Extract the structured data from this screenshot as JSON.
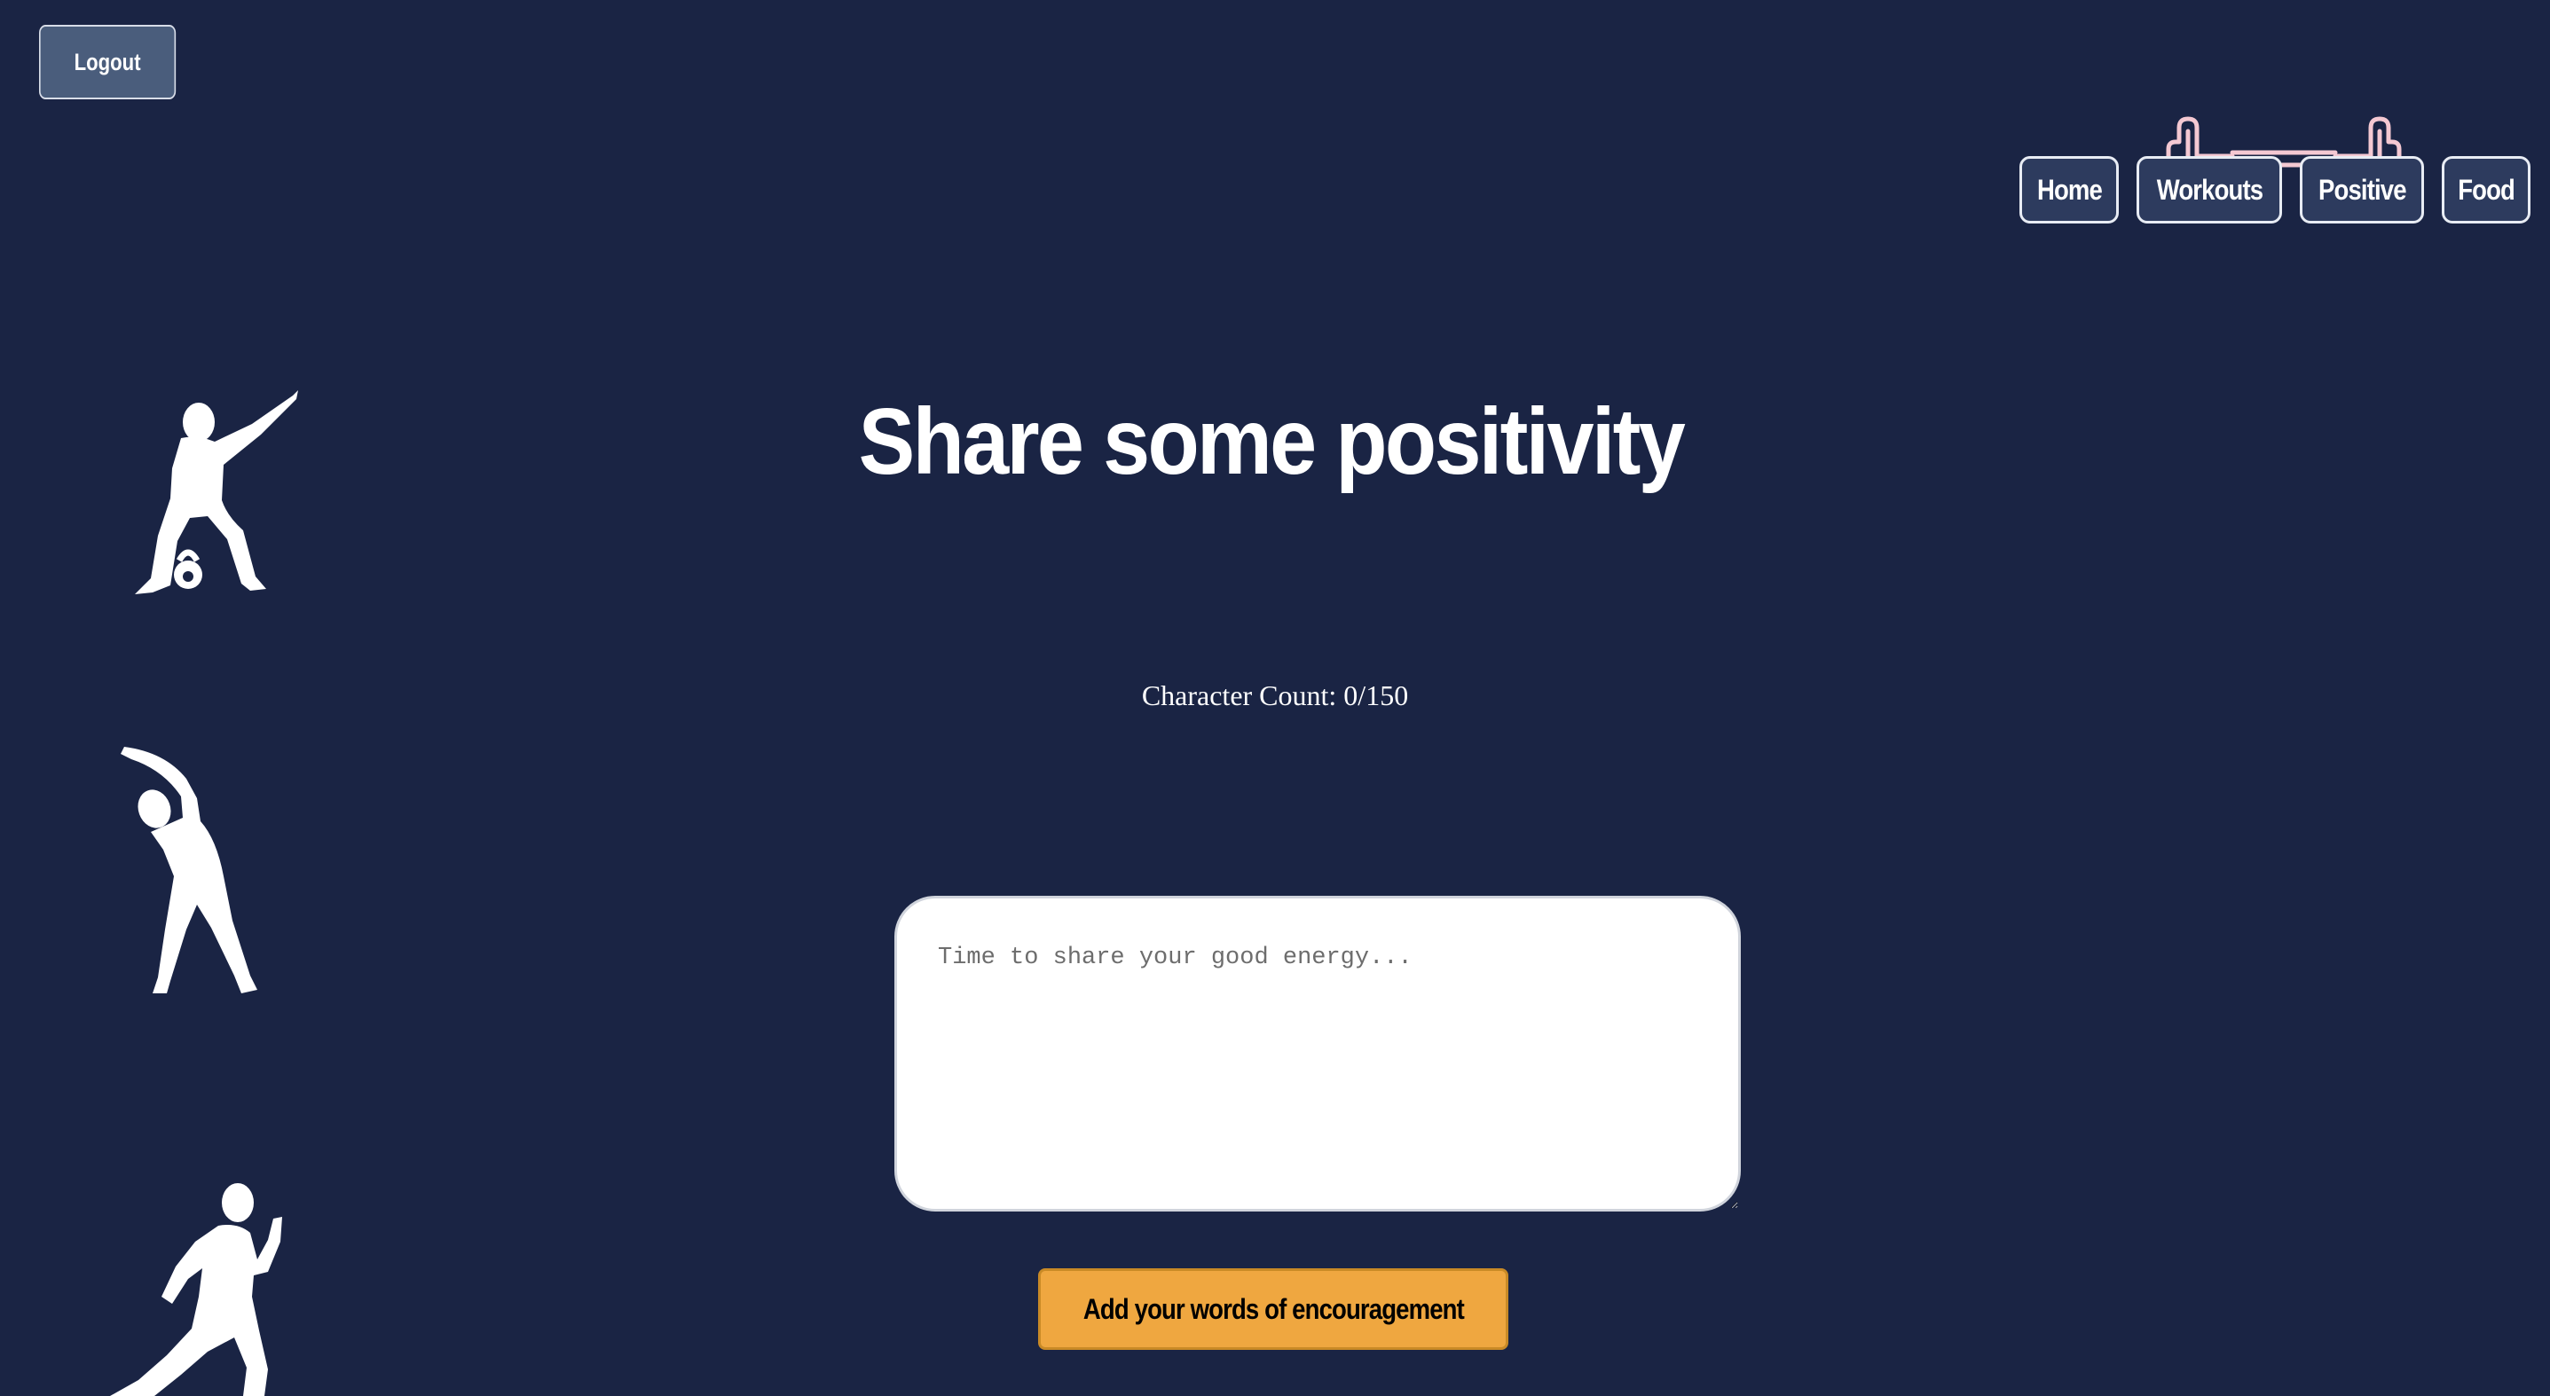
{
  "header": {
    "logout_label": "Logout"
  },
  "logo": {
    "icon": "dumbbell-logo-icon",
    "color": "#f4c8d2"
  },
  "nav": {
    "items": [
      {
        "label": "Home"
      },
      {
        "label": "Workouts"
      },
      {
        "label": "Positive"
      },
      {
        "label": "Food"
      }
    ]
  },
  "decorations": {
    "figures": [
      "kettlebell-squat-figure-icon",
      "side-stretch-figure-icon",
      "runner-figure-icon"
    ]
  },
  "main": {
    "title": "Share some positivity",
    "character_count": "Character Count: 0/150",
    "input_placeholder": "Time to share your good energy...",
    "input_value": "",
    "submit_label": "Add your words of encouragement"
  },
  "colors": {
    "background": "#1a2444",
    "nav_button_bg": "#2d3b5e",
    "logout_bg": "#4a5d7c",
    "submit_bg": "#efa740",
    "text": "#ffffff"
  }
}
